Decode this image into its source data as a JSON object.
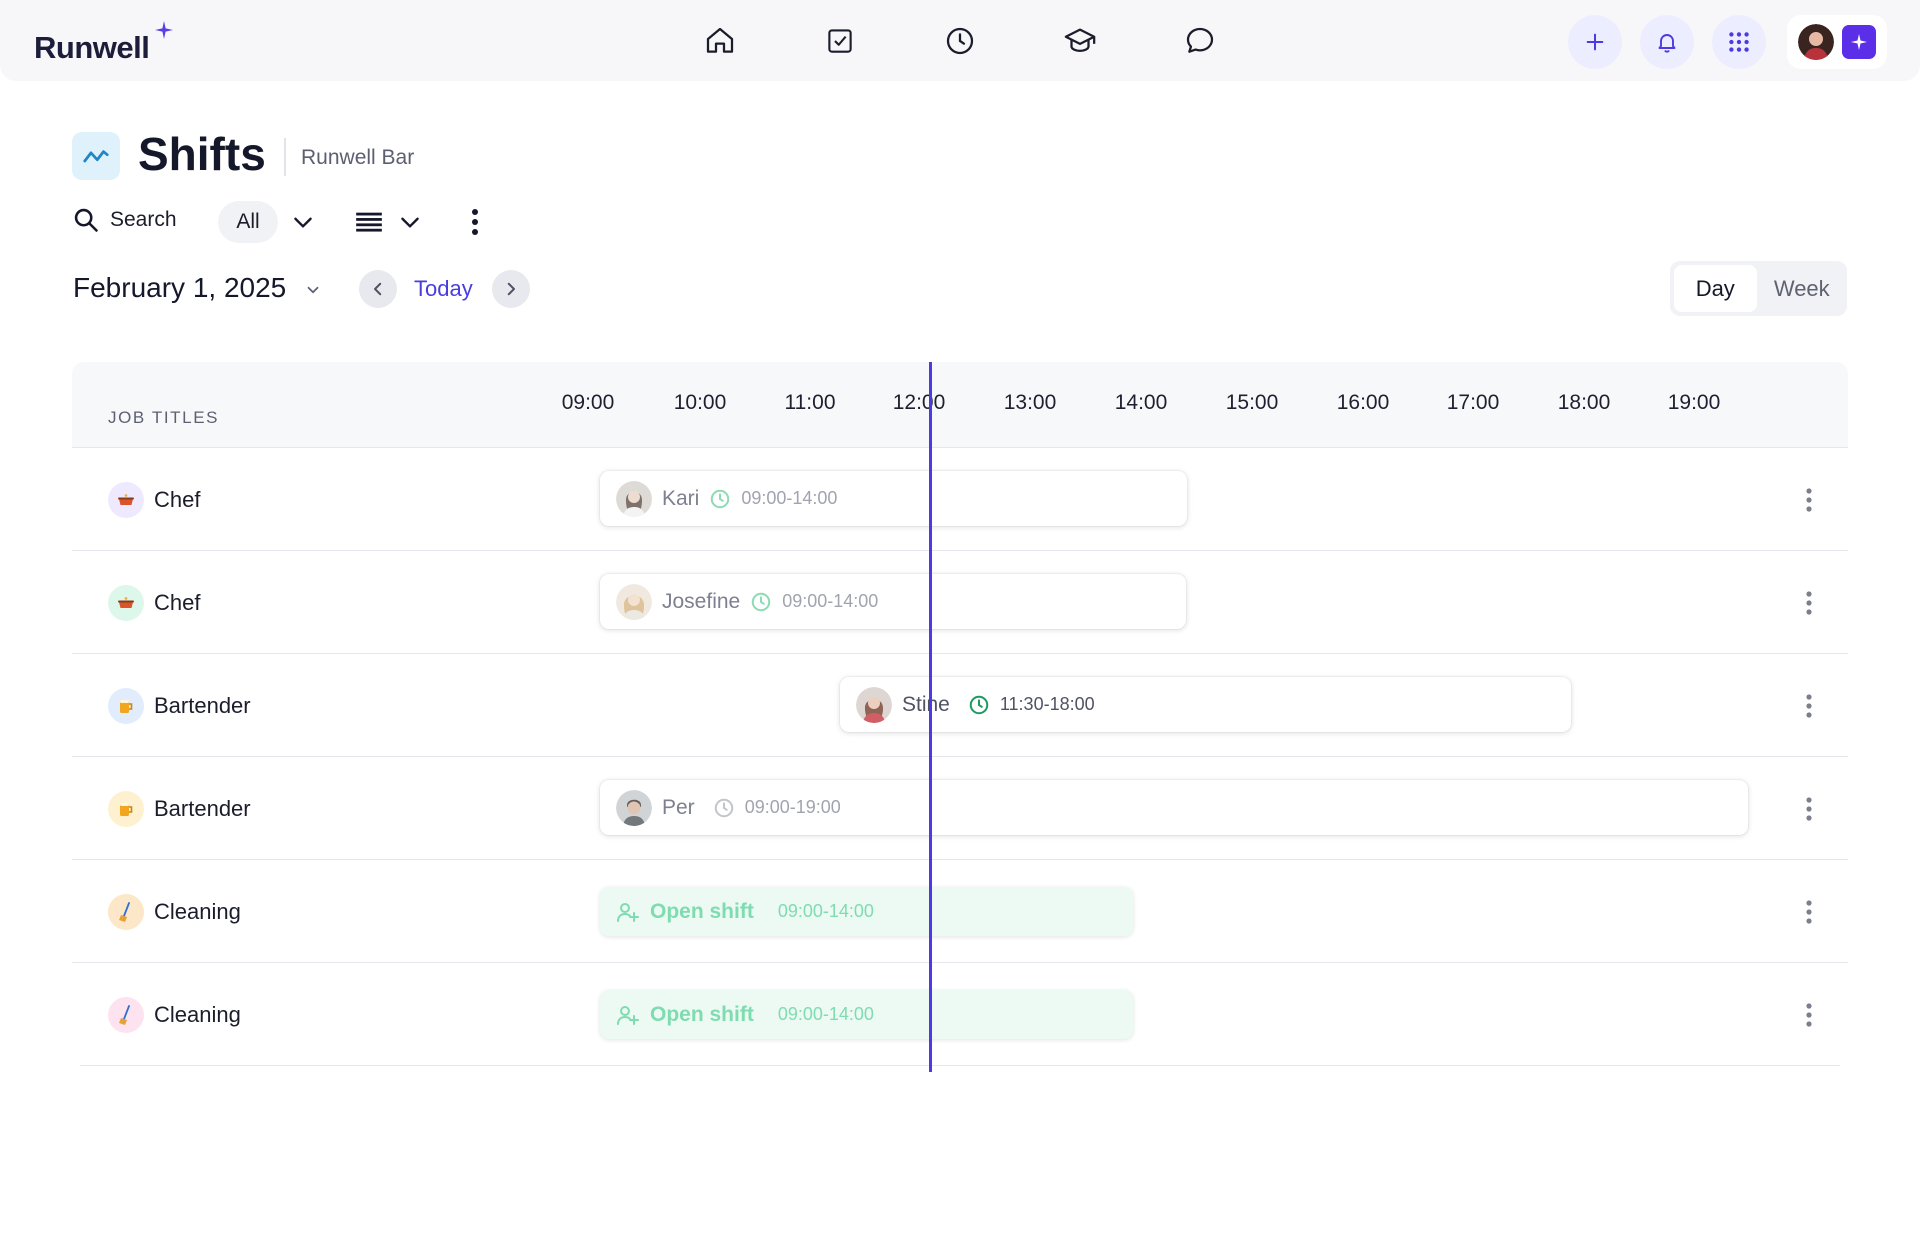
{
  "app": {
    "logo": "Runwell",
    "accent": "#4b3be0"
  },
  "nav": {
    "items": [
      {
        "icon": "home-icon"
      },
      {
        "icon": "checkbox-icon"
      },
      {
        "icon": "clock-icon"
      },
      {
        "icon": "graduation-cap-icon"
      },
      {
        "icon": "chat-icon"
      }
    ],
    "actions": [
      "plus-icon",
      "bell-icon",
      "apps-grid-icon",
      "sparkle-icon"
    ]
  },
  "page": {
    "title": "Shifts",
    "subtitle": "Runwell Bar"
  },
  "toolbar": {
    "search_label": "Search",
    "filter_value": "All"
  },
  "date_nav": {
    "date": "February 1, 2025",
    "today_label": "Today",
    "views": [
      "Day",
      "Week"
    ],
    "active_view": "Day"
  },
  "schedule": {
    "column_label": "JOB TITLES",
    "hours": [
      "09:00",
      "10:00",
      "11:00",
      "12:00",
      "13:00",
      "14:00",
      "15:00",
      "16:00",
      "17:00",
      "18:00",
      "19:00"
    ],
    "current_time": "12:07",
    "rows": [
      {
        "role": "Chef",
        "role_icon": "pot-icon",
        "role_color": "#efe9ff",
        "shift": {
          "person": "Kari",
          "time": "09:00-14:00",
          "open": false
        }
      },
      {
        "role": "Chef",
        "role_icon": "pot-icon",
        "role_color": "#ddf7ea",
        "shift": {
          "person": "Josefine",
          "time": "09:00-14:00",
          "open": false
        }
      },
      {
        "role": "Bartender",
        "role_icon": "beer-icon",
        "role_color": "#e1ecfc",
        "shift": {
          "person": "Stine",
          "time": "11:30-18:00",
          "open": false
        }
      },
      {
        "role": "Bartender",
        "role_icon": "beer-icon",
        "role_color": "#fdf1cf",
        "shift": {
          "person": "Per",
          "time": "09:00-19:00",
          "open": false
        }
      },
      {
        "role": "Cleaning",
        "role_icon": "broom-icon",
        "role_color": "#fde7c9",
        "shift": {
          "person": "Open shift",
          "time": "09:00-14:00",
          "open": true
        }
      },
      {
        "role": "Cleaning",
        "role_icon": "broom-icon",
        "role_color": "#fde3ef",
        "shift": {
          "person": "Open shift",
          "time": "09:00-14:00",
          "open": true
        }
      }
    ]
  }
}
